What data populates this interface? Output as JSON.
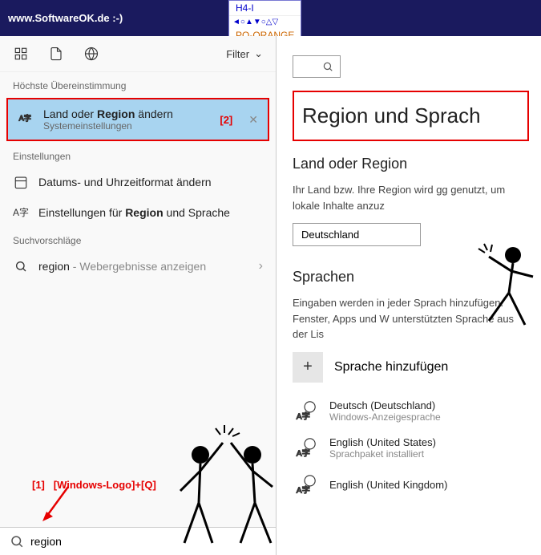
{
  "topbar": {
    "site": "www.SoftwareOK.de :-)"
  },
  "dropdown": {
    "item1": "H4-I",
    "item2": "PO-ORANGE"
  },
  "cortana": {
    "filter_label": "Filter",
    "section_best": "Höchste Übereinstimmung",
    "best_result": {
      "title_pre": "Land oder ",
      "title_bold": "Region",
      "title_post": " ändern",
      "subtitle": "Systemeinstellungen",
      "annotation": "[2]"
    },
    "section_settings": "Einstellungen",
    "result_datetime": "Datums- und Uhrzeitformat ändern",
    "result_region": {
      "pre": "Einstellungen für ",
      "bold": "Region",
      "post": " und Sprache"
    },
    "section_suggest": "Suchvorschläge",
    "suggest": {
      "term": "region",
      "hint": " - Webergebnisse anzeigen"
    },
    "search_value": "region"
  },
  "annotations": {
    "one": "[1]",
    "shortcut": "[Windows-Logo]+[Q]"
  },
  "settings": {
    "title": "Region und Sprach",
    "country_heading": "Land oder Region",
    "country_desc": "Ihr Land bzw. Ihre Region wird gg genutzt, um lokale Inhalte anzuz",
    "country_value": "Deutschland",
    "lang_heading": "Sprachen",
    "lang_desc": "Eingaben werden in jeder Sprach hinzufügen. Fenster, Apps und W unterstützten Sprache aus der Lis",
    "add_lang": "Sprache hinzufügen",
    "langs": [
      {
        "name": "Deutsch (Deutschland)",
        "sub": "Windows-Anzeigesprache"
      },
      {
        "name": "English (United States)",
        "sub": "Sprachpaket installiert"
      },
      {
        "name": "English (United Kingdom)",
        "sub": ""
      }
    ]
  }
}
